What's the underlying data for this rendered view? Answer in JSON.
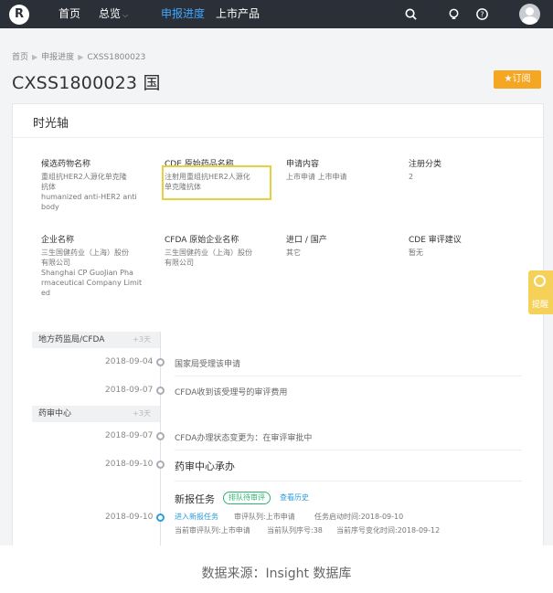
{
  "nav": {
    "logo": "R",
    "items": [
      {
        "label": "首页"
      },
      {
        "label": "总览"
      },
      {
        "label": "申报进度"
      },
      {
        "label": "上市产品"
      }
    ],
    "icons": [
      "search-icon",
      "bulb-icon",
      "help-icon",
      "user-avatar"
    ]
  },
  "breadcrumb": [
    "首页",
    "申报进度",
    "CXSS1800023"
  ],
  "page_title": "CXSS1800023 国",
  "subscribe_label": "订阅",
  "card_title": "时光轴",
  "info": {
    "candidate_label": "候选药物名称",
    "candidate_value": [
      "重组抗HER2人源化单克隆",
      "抗体",
      "humanized anti-HER2 anti",
      "body"
    ],
    "cde_drug_label": "CDE 原始药品名称",
    "cde_drug_value": [
      "注射用重组抗HER2人源化",
      "单克隆抗体"
    ],
    "apply_label": "申请内容",
    "apply_value": "上市申请  上市申请",
    "reg_label": "注册分类",
    "reg_value": "2",
    "company_label": "企业名称",
    "company_value": [
      "三生国健药业（上海）股份",
      "有限公司",
      "Shanghai CP GuoJian Pha",
      "rmaceutical Company Limit",
      "ed"
    ],
    "cfda_company_label": "CFDA 原始企业名称",
    "cfda_company_value": [
      "三生国健药业（上海）股份",
      "有限公司"
    ],
    "import_label": "进口 / 国产",
    "import_value": "其它",
    "cde_advice_label": "CDE 审评建议",
    "cde_advice_value": "暂无"
  },
  "timeline": {
    "stage1": {
      "name": "地方药监局/CFDA",
      "days": "+3天"
    },
    "stage2": {
      "name": "药审中心",
      "days": "+3天"
    },
    "events": [
      {
        "date": "2018-09-04",
        "text": "国家局受理该申请"
      },
      {
        "date": "2018-09-07",
        "text": "CFDA收到该受理号的审评费用"
      },
      {
        "date": "2018-09-07",
        "text": "CFDA办理状态变更为：在审评审批中"
      },
      {
        "date": "2018-09-10",
        "text": "药审中心承办"
      },
      {
        "date": "2018-09-10",
        "text": ""
      }
    ],
    "task": {
      "title": "新报任务",
      "tag": "排队待审评",
      "history": "查看历史",
      "line1": [
        "进入新报任务",
        "审评队列:上市申请",
        "任务启动时间:2018-09-10"
      ],
      "line2": [
        "当前审评队列:上市申请",
        "当前队列序号:38",
        "当前序号变化时间:2018-09-12"
      ]
    }
  },
  "side_tab_label": "提醒",
  "caption": "数据来源：Insight 数据库"
}
